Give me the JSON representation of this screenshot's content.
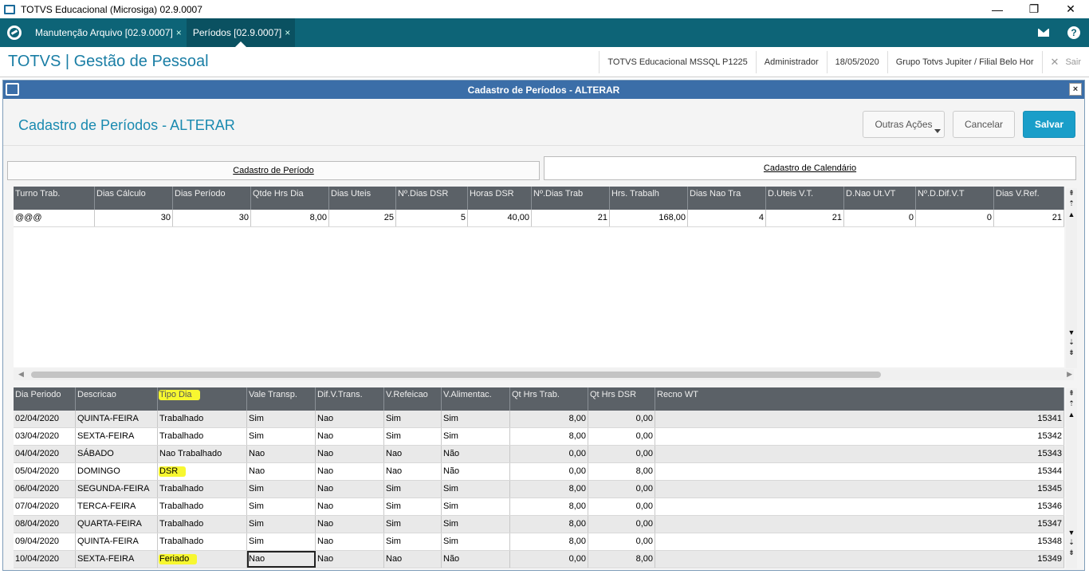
{
  "window": {
    "title": "TOTVS Educacional (Microsiga) 02.9.0007",
    "minimize": "—",
    "restore": "❐",
    "close": "✕"
  },
  "tabs": [
    {
      "label": "Manutenção Arquivo [02.9.0007]",
      "close": "×"
    },
    {
      "label": "Períodos [02.9.0007]",
      "close": "×"
    }
  ],
  "header": {
    "app_title": "TOTVS | Gestão de Pessoal",
    "environment": "TOTVS Educacional MSSQL P1225",
    "user": "Administrador",
    "date": "18/05/2020",
    "company": "Grupo Totvs Jupiter / Filial Belo Hor",
    "exit_label": "Sair",
    "exit_icon": "✕"
  },
  "dialog": {
    "title": "Cadastro de Períodos - ALTERAR",
    "close": "×",
    "heading": "Cadastro de Períodos - ALTERAR",
    "buttons": {
      "other_actions": "Outras Ações",
      "cancel": "Cancelar",
      "save": "Salvar"
    },
    "folders": {
      "period": "Cadastro de Período",
      "calendar": "Cadastro de Calendário"
    }
  },
  "grid_top": {
    "columns": [
      "Turno Trab.",
      "Dias Cálculo",
      "Dias Período",
      "Qtde Hrs Dia",
      "Dias Uteis",
      "Nº.Dias DSR",
      "Horas DSR",
      "Nº.Dias Trab",
      "Hrs. Trabalh",
      "Dias Nao Tra",
      "D.Uteis V.T.",
      "D.Nao Ut.VT",
      "Nº.D.Dif.V.T",
      "Dias V.Ref."
    ],
    "rows": [
      [
        "@@@",
        "30",
        "30",
        "8,00",
        "25",
        "5",
        "40,00",
        "21",
        "168,00",
        "4",
        "21",
        "0",
        "0",
        "21"
      ]
    ]
  },
  "grid_bottom": {
    "columns": [
      "Dia Periodo",
      "Descricao",
      "Tipo Dia",
      "Vale Transp.",
      "Dif.V.Trans.",
      "V.Refeicao",
      "V.Alimentac.",
      "Qt Hrs Trab.",
      "Qt Hrs DSR",
      "Recno WT"
    ],
    "rows": [
      [
        "02/04/2020",
        "QUINTA-FEIRA",
        "Trabalhado",
        "Sim",
        "Nao",
        "Sim",
        "Sim",
        "8,00",
        "0,00",
        "15341"
      ],
      [
        "03/04/2020",
        "SEXTA-FEIRA",
        "Trabalhado",
        "Sim",
        "Nao",
        "Sim",
        "Sim",
        "8,00",
        "0,00",
        "15342"
      ],
      [
        "04/04/2020",
        "SÁBADO",
        "Nao Trabalhado",
        "Nao",
        "Nao",
        "Nao",
        "Não",
        "0,00",
        "0,00",
        "15343"
      ],
      [
        "05/04/2020",
        "DOMINGO",
        "DSR",
        "Nao",
        "Nao",
        "Nao",
        "Não",
        "0,00",
        "8,00",
        "15344"
      ],
      [
        "06/04/2020",
        "SEGUNDA-FEIRA",
        "Trabalhado",
        "Sim",
        "Nao",
        "Sim",
        "Sim",
        "8,00",
        "0,00",
        "15345"
      ],
      [
        "07/04/2020",
        "TERCA-FEIRA",
        "Trabalhado",
        "Sim",
        "Nao",
        "Sim",
        "Sim",
        "8,00",
        "0,00",
        "15346"
      ],
      [
        "08/04/2020",
        "QUARTA-FEIRA",
        "Trabalhado",
        "Sim",
        "Nao",
        "Sim",
        "Sim",
        "8,00",
        "0,00",
        "15347"
      ],
      [
        "09/04/2020",
        "QUINTA-FEIRA",
        "Trabalhado",
        "Sim",
        "Nao",
        "Sim",
        "Sim",
        "8,00",
        "0,00",
        "15348"
      ],
      [
        "10/04/2020",
        "SEXTA-FEIRA",
        "Feriado",
        "Nao",
        "Nao",
        "Nao",
        "Não",
        "0,00",
        "8,00",
        "15349"
      ]
    ]
  },
  "icons": {
    "scroll_top": "⇞",
    "scroll_up_page": "⇡",
    "scroll_up": "▲",
    "scroll_down": "▼",
    "scroll_down_page": "⇣",
    "scroll_bottom": "⇟",
    "scroll_left": "◀",
    "scroll_right": "▶"
  },
  "colors": {
    "accent": "#0d6477",
    "title_text": "#1a7ea5",
    "save_button": "#1a9ec9",
    "highlight": "#f7f730"
  }
}
